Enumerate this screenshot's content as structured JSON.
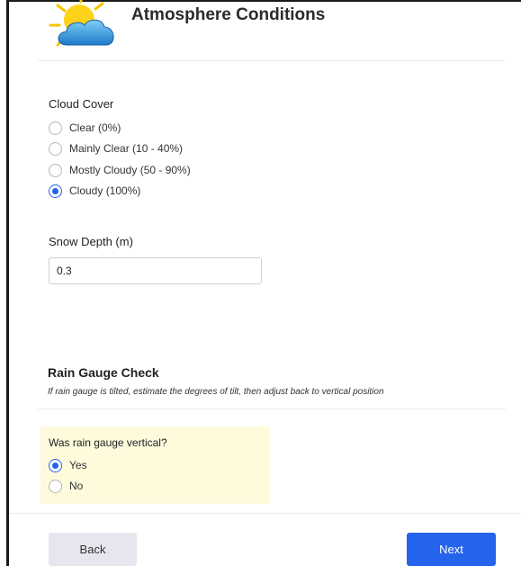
{
  "header": {
    "title": "Atmosphere Conditions",
    "icon": "partly-cloudy-icon"
  },
  "cloud_cover": {
    "label": "Cloud Cover",
    "options": [
      {
        "label": "Clear (0%)",
        "selected": false
      },
      {
        "label": "Mainly Clear (10 - 40%)",
        "selected": false
      },
      {
        "label": "Mostly Cloudy (50 - 90%)",
        "selected": false
      },
      {
        "label": "Cloudy (100%)",
        "selected": true
      }
    ]
  },
  "snow_depth": {
    "label": "Snow Depth (m)",
    "value": "0.3"
  },
  "rain_gauge": {
    "heading": "Rain Gauge Check",
    "helper": "If rain gauge is tilted, estimate the degrees of tilt, then adjust back to vertical position",
    "question": "Was rain gauge vertical?",
    "options": [
      {
        "label": "Yes",
        "selected": true
      },
      {
        "label": "No",
        "selected": false
      }
    ]
  },
  "footer": {
    "back_label": "Back",
    "next_label": "Next"
  },
  "colors": {
    "accent": "#2463eb",
    "highlight": "#fdfbdc",
    "back_button": "#e6e7ee"
  }
}
